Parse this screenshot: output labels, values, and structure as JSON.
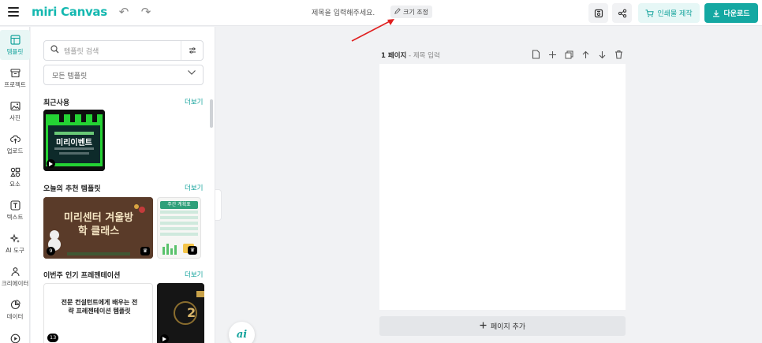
{
  "header": {
    "logo": "miri Canvas",
    "title_placeholder": "제목을 입력해주세요.",
    "resize_label": "크기 조정",
    "print_label": "인쇄물 제작",
    "download_label": "다운로드"
  },
  "rail": {
    "items": [
      {
        "label": "템플릿",
        "icon": "template-icon"
      },
      {
        "label": "프로젝트",
        "icon": "project-icon"
      },
      {
        "label": "사진",
        "icon": "photo-icon"
      },
      {
        "label": "업로드",
        "icon": "upload-icon"
      },
      {
        "label": "요소",
        "icon": "elements-icon"
      },
      {
        "label": "텍스트",
        "icon": "text-icon"
      },
      {
        "label": "AI 도구",
        "icon": "ai-tool-icon"
      },
      {
        "label": "크리에이터",
        "icon": "creator-icon"
      },
      {
        "label": "데이터",
        "icon": "data-icon"
      },
      {
        "label": "",
        "icon": "play-icon"
      }
    ]
  },
  "panel": {
    "search_placeholder": "템플릿 검색",
    "filter_value": "모든 템플릿",
    "recent_title": "최근사용",
    "recommended_title": "오늘의 추천 템플릿",
    "popular_title": "이번주 인기 프레젠테이션",
    "more_label": "더보기",
    "thumbs": {
      "recent_1": "미리이벤트",
      "rec_1": "미리센터 겨울방학 클래스",
      "rec_1_count": "9",
      "rec_2": "주간 계획표",
      "pop_1": "전문 컨설턴트에게 배우는 전략 프레젠테이션 템플릿",
      "pop_1_count": "13",
      "pop_2": "2"
    }
  },
  "canvas": {
    "page_label": "1 페이지",
    "page_title_placeholder": "제목 입력",
    "add_page_label": "페이지 추가"
  },
  "colors": {
    "accent": "#14a8a2",
    "annotation_arrow": "#e02020"
  }
}
